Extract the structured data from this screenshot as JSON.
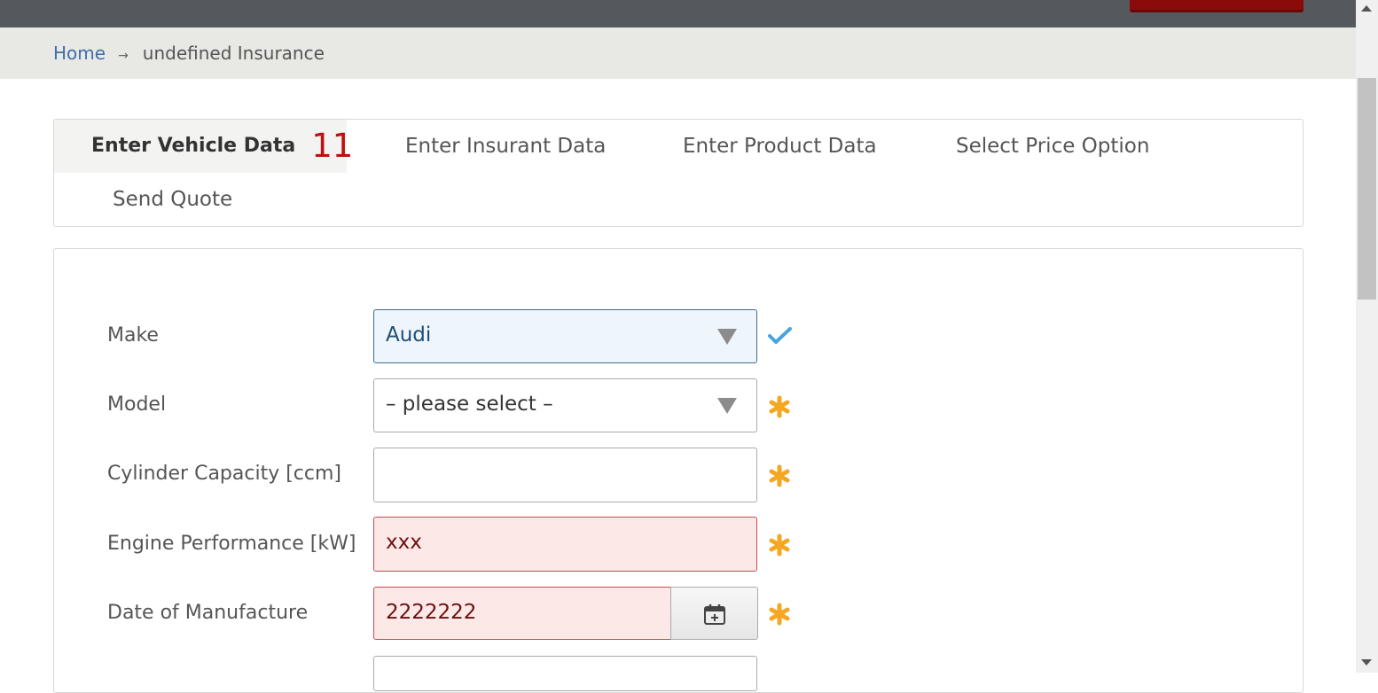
{
  "breadcrumb": {
    "home": "Home",
    "separator": "→",
    "current": "undefined Insurance"
  },
  "tabs": [
    {
      "label": "Enter Vehicle Data",
      "count": "11",
      "active": true
    },
    {
      "label": "Enter Insurant Data"
    },
    {
      "label": "Enter Product Data"
    },
    {
      "label": "Select Price Option"
    },
    {
      "label": "Send Quote"
    }
  ],
  "form": {
    "make": {
      "label": "Make",
      "value": "Audi",
      "status": "valid"
    },
    "model": {
      "label": "Model",
      "value": "– please select –",
      "status": "required"
    },
    "cylinder_capacity": {
      "label": "Cylinder Capacity [ccm]",
      "value": "",
      "status": "required"
    },
    "engine_performance": {
      "label": "Engine Performance [kW]",
      "value": "xxx",
      "status": "required"
    },
    "date_of_manufacture": {
      "label": "Date of Manufacture",
      "value": "2222222",
      "status": "required"
    }
  },
  "icons": {
    "valid": "checkmark-icon",
    "required": "asterisk-icon",
    "calendar": "calendar-plus-icon"
  },
  "colors": {
    "accent_red": "#c00f0f",
    "link_blue": "#3f6fa8",
    "required_orange": "#f5a623",
    "valid_blue": "#4aa3df"
  }
}
